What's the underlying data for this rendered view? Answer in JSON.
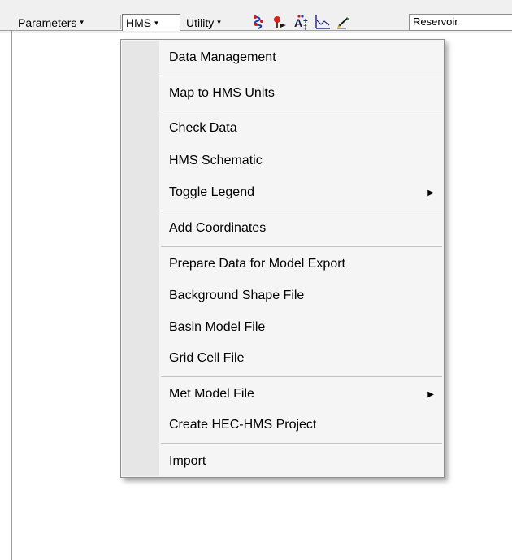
{
  "toolbar": {
    "parameters_label": "Parameters",
    "hms_label": "HMS",
    "utility_label": "Utility",
    "dropdown_arrow": "▾",
    "combo_value": "Reservoir",
    "icons": [
      "flow-path-icon",
      "point-marker-icon",
      "text-label-icon",
      "graph-icon",
      "edit-pencil-icon"
    ]
  },
  "hms_menu": {
    "items": [
      {
        "label": "Data Management",
        "has_submenu": false
      },
      {
        "label": "Map to HMS Units",
        "has_submenu": false
      },
      {
        "label": "Check Data",
        "has_submenu": false
      },
      {
        "label": "HMS Schematic",
        "has_submenu": false
      },
      {
        "label": "Toggle Legend",
        "has_submenu": true
      },
      {
        "label": "Add Coordinates",
        "has_submenu": false
      },
      {
        "label": "Prepare Data for Model Export",
        "has_submenu": false
      },
      {
        "label": "Background Shape File",
        "has_submenu": false
      },
      {
        "label": "Basin Model File",
        "has_submenu": false
      },
      {
        "label": "Grid Cell File",
        "has_submenu": false
      },
      {
        "label": "Met Model File",
        "has_submenu": true
      },
      {
        "label": "Create HEC-HMS Project",
        "has_submenu": false
      },
      {
        "label": "Import",
        "has_submenu": false
      }
    ],
    "submenu_arrow": "▶"
  }
}
